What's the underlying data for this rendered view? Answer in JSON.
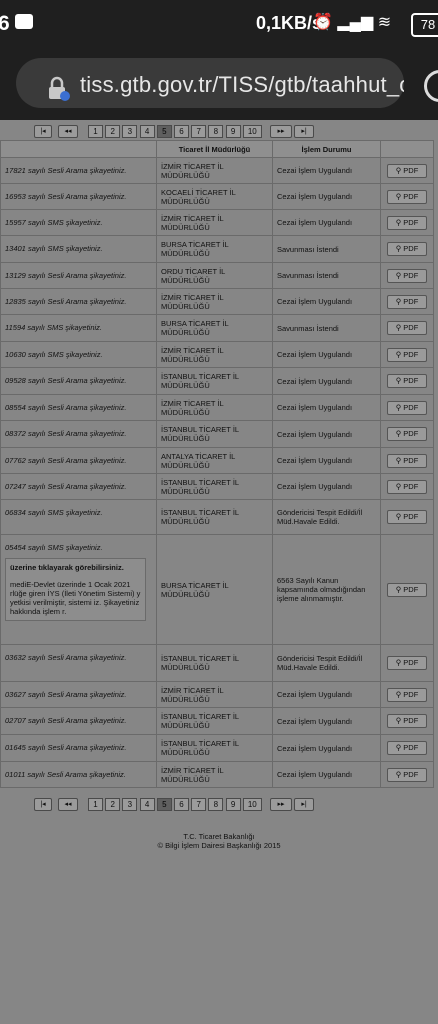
{
  "status": {
    "left_num": "6",
    "speed": "0,1KB/s",
    "battery": "78"
  },
  "browser": {
    "url": "tiss.gtb.gov.tr/TISS/gtb/taahhut_oauth"
  },
  "pager": {
    "pages": [
      "1",
      "2",
      "3",
      "4",
      "5",
      "6",
      "7",
      "8",
      "9",
      "10"
    ],
    "active": "5",
    "first": "|◂",
    "prev": "◂◂",
    "next": "▸▸",
    "last": "▸|"
  },
  "table": {
    "headers": [
      "",
      "Ticaret İl Müdürlüğü",
      "İşlem Durumu",
      ""
    ],
    "rows": [
      {
        "complaint": "17821 sayılı Sesli Arama şikayetiniz.",
        "office": "İZMİR TİCARET İL MÜDÜRLÜĞÜ",
        "status": "Cezai İşlem Uygulandı",
        "pdf": "PDF"
      },
      {
        "complaint": "16953 sayılı Sesli Arama şikayetiniz.",
        "office": "KOCAELİ TİCARET İL MÜDÜRLÜĞÜ",
        "status": "Cezai İşlem Uygulandı",
        "pdf": "PDF"
      },
      {
        "complaint": "15957 sayılı SMS şikayetiniz.",
        "office": "İZMİR TİCARET İL MÜDÜRLÜĞÜ",
        "status": "Cezai İşlem Uygulandı",
        "pdf": "PDF"
      },
      {
        "complaint": "13401 sayılı SMS şikayetiniz.",
        "office": "BURSA TİCARET İL MÜDÜRLÜĞÜ",
        "status": "Savunması İstendi",
        "pdf": "PDF"
      },
      {
        "complaint": "13129 sayılı Sesli Arama şikayetiniz.",
        "office": "ORDU TİCARET İL MÜDÜRLÜĞÜ",
        "status": "Savunması İstendi",
        "pdf": "PDF"
      },
      {
        "complaint": "12835 sayılı Sesli Arama şikayetiniz.",
        "office": "İZMİR TİCARET İL MÜDÜRLÜĞÜ",
        "status": "Cezai İşlem Uygulandı",
        "pdf": "PDF"
      },
      {
        "complaint": "11594 sayılı SMS şikayetiniz.",
        "office": "BURSA TİCARET İL MÜDÜRLÜĞÜ",
        "status": "Savunması İstendi",
        "pdf": "PDF"
      },
      {
        "complaint": "10630 sayılı SMS şikayetiniz.",
        "office": "İZMİR TİCARET İL MÜDÜRLÜĞÜ",
        "status": "Cezai İşlem Uygulandı",
        "pdf": "PDF"
      },
      {
        "complaint": "09528 sayılı Sesli Arama şikayetiniz.",
        "office": "İSTANBUL TİCARET İL MÜDÜRLÜĞÜ",
        "status": "Cezai İşlem Uygulandı",
        "pdf": "PDF"
      },
      {
        "complaint": "08554 sayılı Sesli Arama şikayetiniz.",
        "office": "İZMİR TİCARET İL MÜDÜRLÜĞÜ",
        "status": "Cezai İşlem Uygulandı",
        "pdf": "PDF"
      },
      {
        "complaint": "08372 sayılı Sesli Arama şikayetiniz.",
        "office": "İSTANBUL TİCARET İL MÜDÜRLÜĞÜ",
        "status": "Cezai İşlem Uygulandı",
        "pdf": "PDF"
      },
      {
        "complaint": "07762 sayılı Sesli Arama şikayetiniz.",
        "office": "ANTALYA TİCARET İL MÜDÜRLÜĞÜ",
        "status": "Cezai İşlem Uygulandı",
        "pdf": "PDF"
      },
      {
        "complaint": "07247 sayılı Sesli Arama şikayetiniz.",
        "office": "İSTANBUL TİCARET İL MÜDÜRLÜĞÜ",
        "status": "Cezai İşlem Uygulandı",
        "pdf": "PDF"
      },
      {
        "complaint": "06834 sayılı SMS şikayetiniz.",
        "office": "İSTANBUL TİCARET İL MÜDÜRLÜĞÜ",
        "status": "Göndericisi Tespit Edildi/İl Müd.Havale Edildi.",
        "pdf": "PDF"
      },
      {
        "complaint": "05454 sayılı SMS şikayetiniz.",
        "office": "BURSA TİCARET İL MÜDÜRLÜĞÜ",
        "status": "6563 Sayılı Kanun kapsamında olmadığından işleme alınmamıştır.",
        "pdf": "PDF",
        "info_heading": "üzerine tıklayarak görebilirsiniz.",
        "info_body": "mediE-Devlet üzerinde 1 Ocak 2021 rlüğe giren İYS (İleti Yönetim Sistemi) y yetkisi verilmiştir, sistemi iz. Şikayetiniz hakkında işlem r."
      },
      {
        "complaint": "03632 sayılı Sesli Arama şikayetiniz.",
        "office": "İSTANBUL TİCARET İL MÜDÜRLÜĞÜ",
        "status": "Göndericisi Tespit Edildi/İl Müd.Havale Edildi.",
        "pdf": "PDF"
      },
      {
        "complaint": "03627 sayılı Sesli Arama şikayetiniz.",
        "office": "İZMİR TİCARET İL MÜDÜRLÜĞÜ",
        "status": "Cezai İşlem Uygulandı",
        "pdf": "PDF"
      },
      {
        "complaint": "02707 sayılı Sesli Arama şikayetiniz.",
        "office": "İSTANBUL TİCARET İL MÜDÜRLÜĞÜ",
        "status": "Cezai İşlem Uygulandı",
        "pdf": "PDF"
      },
      {
        "complaint": "01645 sayılı Sesli Arama şikayetiniz.",
        "office": "İSTANBUL TİCARET İL MÜDÜRLÜĞÜ",
        "status": "Cezai İşlem Uygulandı",
        "pdf": "PDF"
      },
      {
        "complaint": "01011 sayılı Sesli Arama şikayetiniz.",
        "office": "İZMİR TİCARET İL MÜDÜRLÜĞÜ",
        "status": "Cezai İşlem Uygulandı",
        "pdf": "PDF"
      }
    ]
  },
  "footer": {
    "line1": "T.C. Ticaret Bakanlığı",
    "line2": "© Bilgi İşlem Dairesi Başkanlığı 2015"
  }
}
